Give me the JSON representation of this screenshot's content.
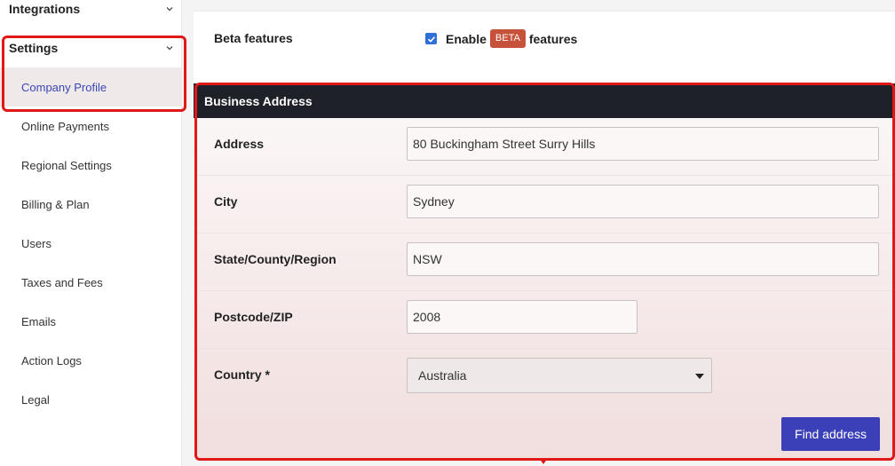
{
  "sidebar": {
    "groups": [
      {
        "label": "Integrations"
      },
      {
        "label": "Settings"
      }
    ],
    "items": [
      {
        "label": "Company Profile",
        "active": true
      },
      {
        "label": "Online Payments"
      },
      {
        "label": "Regional Settings"
      },
      {
        "label": "Billing & Plan"
      },
      {
        "label": "Users"
      },
      {
        "label": "Taxes and Fees"
      },
      {
        "label": "Emails"
      },
      {
        "label": "Action Logs"
      },
      {
        "label": "Legal"
      }
    ]
  },
  "beta": {
    "label": "Beta features",
    "checked": true,
    "enable_text": "Enable",
    "badge": "BETA",
    "suffix_text": "features"
  },
  "business_address": {
    "title": "Business Address",
    "fields": {
      "address": {
        "label": "Address",
        "value": "80 Buckingham Street Surry Hills"
      },
      "city": {
        "label": "City",
        "value": "Sydney"
      },
      "state": {
        "label": "State/County/Region",
        "value": "NSW"
      },
      "postcode": {
        "label": "Postcode/ZIP",
        "value": "2008"
      },
      "country": {
        "label": "Country *",
        "value": "Australia"
      }
    },
    "find_button": "Find address"
  },
  "colors": {
    "accent": "#3b40b8",
    "beta_badge": "#c6523a",
    "header_bg": "#1e2128",
    "highlight": "#e01818"
  }
}
